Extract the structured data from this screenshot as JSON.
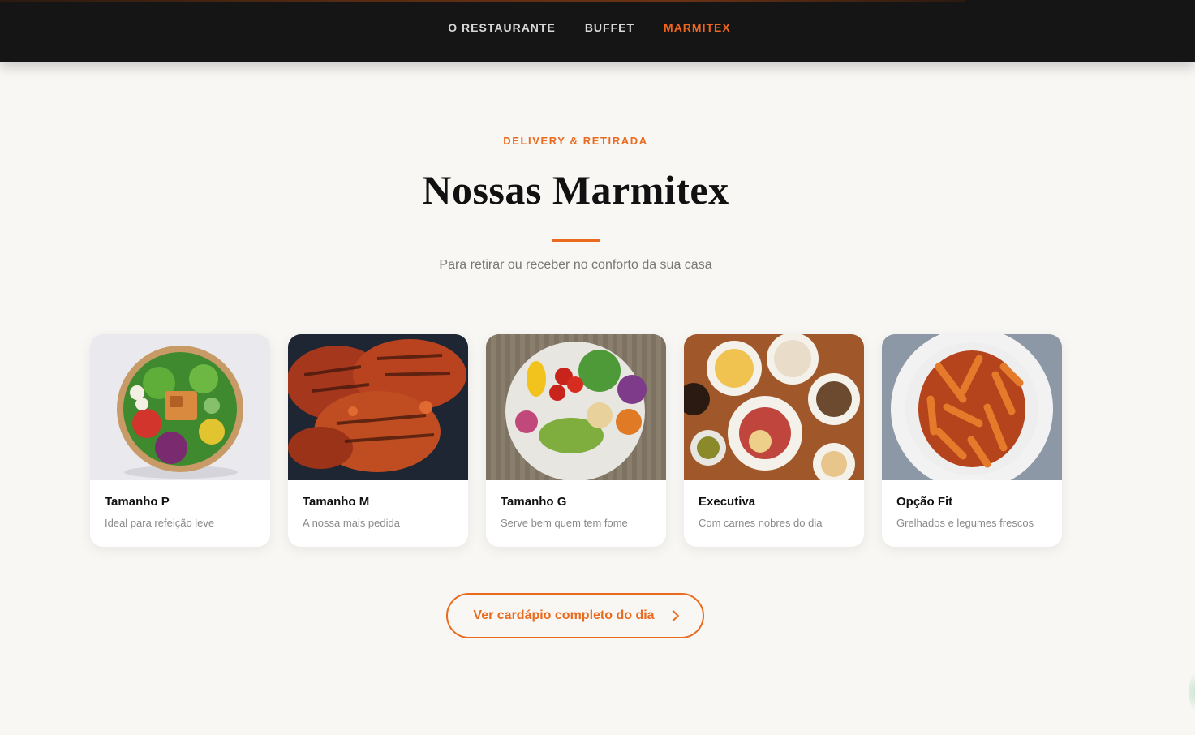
{
  "nav": {
    "items": [
      "O RESTAURANTE",
      "BUFFET",
      "MARMITEX"
    ],
    "active": "MARMITEX"
  },
  "section": {
    "eyebrow": "DELIVERY & RETIRADA",
    "title": "Nossas Marmitex",
    "subtitle": "Para retirar ou receber no conforto da sua casa"
  },
  "cards": [
    {
      "name": "Tamanho P",
      "desc": "Ideal para refeição leve",
      "image": "salad-bowl"
    },
    {
      "name": "Tamanho M",
      "desc": "A nossa mais pedida",
      "image": "grilled-chicken"
    },
    {
      "name": "Tamanho G",
      "desc": "Serve bem quem tem fome",
      "image": "veggie-plate"
    },
    {
      "name": "Executiva",
      "desc": "Com carnes nobres do dia",
      "image": "table-spread"
    },
    {
      "name": "Opção Fit",
      "desc": "Grelhados e legumes frescos",
      "image": "penne-pasta"
    }
  ],
  "cta": {
    "label": "Ver cardápio completo do dia",
    "icon": "chevron-right-icon"
  },
  "colors": {
    "accent": "#ea6a1e",
    "navbar": "#151515",
    "background": "#f8f7f4"
  }
}
